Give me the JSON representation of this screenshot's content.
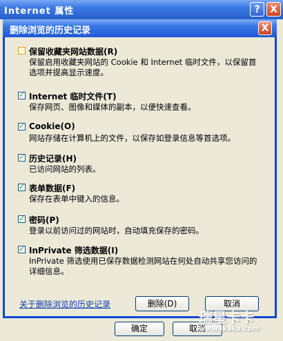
{
  "back_window": {
    "title": "Internet 属性",
    "help_label": "?",
    "close_label": "X",
    "ok_label": "确定",
    "cancel_label": "取消"
  },
  "dialog": {
    "title": "删除浏览的历史记录",
    "close_label": "X",
    "options": [
      {
        "title": "保留收藏夹网站数据(R)",
        "desc": "保留启用收藏夹网站的 Cookie 和 Internet 临时文件，以保留首选项并提高显示速度。",
        "checked": false
      },
      {
        "title": "Internet 临时文件(T)",
        "desc": "保存网页、图像和媒体的副本，以便快速查看。",
        "checked": true
      },
      {
        "title": "Cookie(O)",
        "desc": "网站存储在计算机上的文件，以保存如登录信息等首选项。",
        "checked": true
      },
      {
        "title": "历史记录(H)",
        "desc": "已访问网站的列表。",
        "checked": true
      },
      {
        "title": "表单数据(F)",
        "desc": "保存在表单中键入的信息。",
        "checked": true
      },
      {
        "title": "密码(P)",
        "desc": "登录以前访问过的网站时，自动填充保存的密码。",
        "checked": true
      },
      {
        "title": "InPrivate 筛选数据(I)",
        "desc": "InPrivate 筛选使用已保存数据检测网站在何处自动共享您访问的详细信息。",
        "checked": true
      }
    ],
    "help_link": "关于删除浏览的历史记录",
    "delete_label": "删除(D)",
    "cancel_label": "取消"
  },
  "watermark": {
    "line1": "瑞星卡卡",
    "line2": "www.ikaka.com"
  }
}
